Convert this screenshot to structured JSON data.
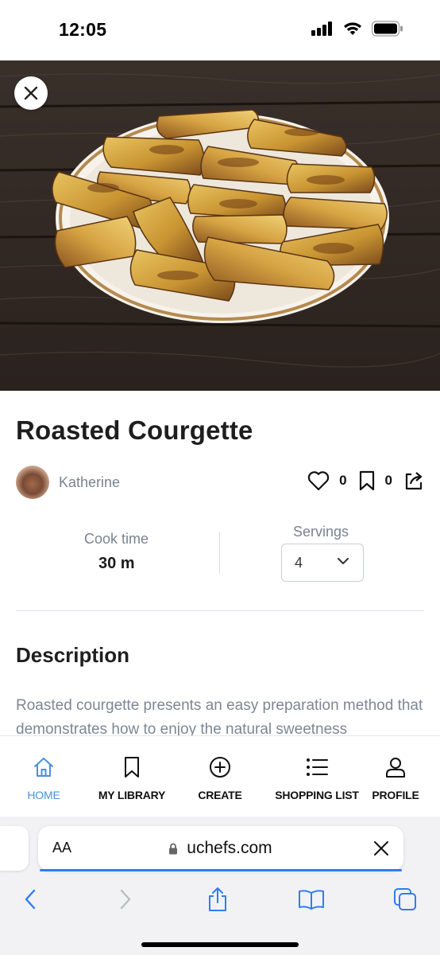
{
  "status_bar": {
    "time": "12:05"
  },
  "recipe": {
    "title": "Roasted Courgette",
    "author": "Katherine",
    "likes": "0",
    "saves": "0",
    "cook_time_label": "Cook time",
    "cook_time_value": "30 m",
    "servings_label": "Servings",
    "servings_value": "4",
    "description_heading": "Description",
    "description_text": "Roasted courgette presents an easy preparation method that demonstrates how to enjoy the natural sweetness"
  },
  "bottom_nav": {
    "items": [
      {
        "label": "HOME",
        "icon": "home-icon",
        "active": true
      },
      {
        "label": "MY LIBRARY",
        "icon": "bookmark-icon",
        "active": false
      },
      {
        "label": "CREATE",
        "icon": "plus-circle-icon",
        "active": false
      },
      {
        "label": "SHOPPING LIST",
        "icon": "list-icon",
        "active": false
      },
      {
        "label": "PROFILE",
        "icon": "user-icon",
        "active": false
      }
    ]
  },
  "browser": {
    "aa_label": "AA",
    "url": "uchefs.com"
  },
  "colors": {
    "accent": "#4a90d9",
    "safari_blue": "#2f7cf6",
    "muted_text": "#7d8793"
  }
}
